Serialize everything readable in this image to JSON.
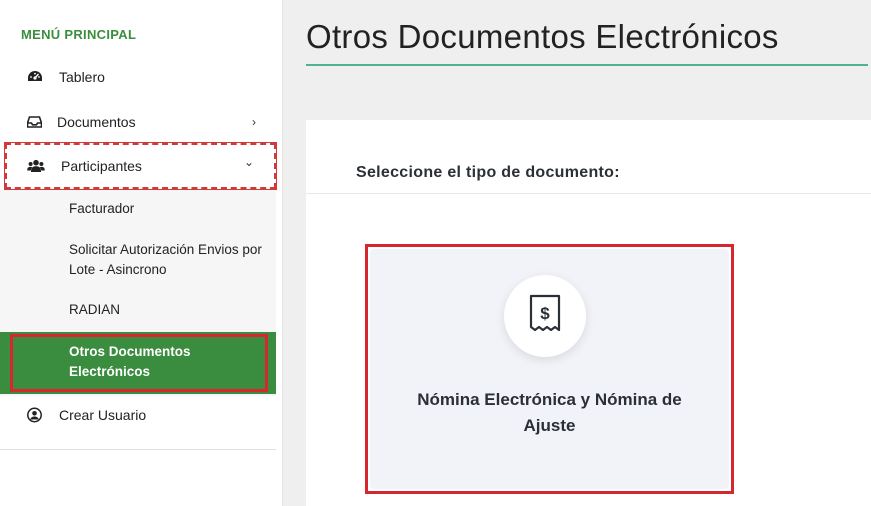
{
  "sidebar": {
    "menu_title": "MENÚ PRINCIPAL",
    "items": [
      {
        "label": "Tablero",
        "icon": "dashboard-icon"
      },
      {
        "label": "Documentos",
        "icon": "inbox-icon"
      },
      {
        "label": "Participantes",
        "icon": "users-icon"
      },
      {
        "label": "Crear Usuario",
        "icon": "user-circle-icon"
      }
    ],
    "submenu": [
      {
        "label": "Facturador"
      },
      {
        "label": "Solicitar Autorización Envios por Lote - Asincrono"
      },
      {
        "label": "RADIAN"
      },
      {
        "label": "Otros Documentos Electrónicos"
      }
    ],
    "chevron_right": "›",
    "chevron_down": "⌄"
  },
  "main": {
    "title": "Otros Documentos Electrónicos",
    "heading": "Seleccione el tipo de documento:",
    "card": {
      "label": "Nómina Electrónica y Nómina de Ajuste",
      "icon": "receipt-dollar-icon"
    }
  },
  "colors": {
    "accent_green": "#3a8c3f",
    "title_rule": "#4fb291",
    "highlight_red": "#d7262e"
  }
}
